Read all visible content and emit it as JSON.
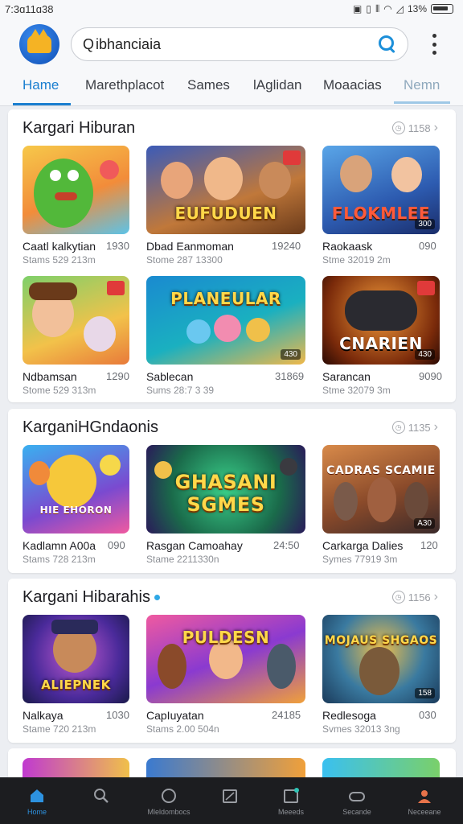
{
  "status_bar": {
    "time": "7:3ɑ11ɑ38",
    "battery": "13%"
  },
  "search": {
    "prefix": "Q",
    "value": "ibhanciaia"
  },
  "tabs": [
    "Hame",
    "Marethplacot",
    "Sames",
    "lAglidan",
    "Moaacias",
    "Nemn"
  ],
  "sections": [
    {
      "title": "Kargari Hiburan",
      "count": "1158",
      "items": [
        {
          "name": "Caatl kalkytian",
          "num": "1930",
          "sub": "Stams 529 213m",
          "thumb_text": "",
          "badge": ""
        },
        {
          "name": "Dbad Eanmoman",
          "num": "19240",
          "sub": "Stome 287 13300",
          "thumb_text": "EUFUDUEN",
          "badge": ""
        },
        {
          "name": "Raokaask",
          "num": "090",
          "sub": "Stme 32019 2m",
          "thumb_text": "FLOKMLEE",
          "badge": "300"
        },
        {
          "name": "Ndbamsan",
          "num": "1290",
          "sub": "Stome 529 313m",
          "thumb_text": "",
          "badge": ""
        },
        {
          "name": "Sablecan",
          "num": "31869",
          "sub": "Sums 28:7 3 39",
          "thumb_text": "PLANEULAR",
          "badge": "430"
        },
        {
          "name": "Sarancan",
          "num": "9090",
          "sub": "Stme 32079 3m",
          "thumb_text": "CNARIEN",
          "badge": "430"
        }
      ]
    },
    {
      "title": "KarganiHGndaonis",
      "count": "1135",
      "items": [
        {
          "name": "Kadlamn A00a",
          "num": "090",
          "sub": "Stams 728 213m",
          "thumb_text": "HIE EHORON",
          "badge": ""
        },
        {
          "name": "Rasgan Camoahay",
          "num": "24:50",
          "sub": "Stame 2211330n",
          "thumb_text": "GHASANI SGMES",
          "badge": ""
        },
        {
          "name": "Carkarga Dalies",
          "num": "120",
          "sub": "Symes 77919 3m",
          "thumb_text": "CADRAS SCAMIE",
          "badge": "A30"
        }
      ]
    },
    {
      "title": "Kargani Hibarahis",
      "count": "1156",
      "items": [
        {
          "name": "Nalkaya",
          "num": "1030",
          "sub": "Stame 720 213m",
          "thumb_text": "ALIEPNEK",
          "badge": ""
        },
        {
          "name": "CapIuyatan",
          "num": "24185",
          "sub": "Stams 2.00 504n",
          "thumb_text": "PULDESN",
          "badge": ""
        },
        {
          "name": "Redlesoga",
          "num": "030",
          "sub": "Svmes 32013 3ng",
          "thumb_text": "MOJAUS SHGAOS",
          "badge": "158"
        }
      ]
    }
  ],
  "bottom_nav": [
    {
      "label": "Home",
      "icon": "home-icon"
    },
    {
      "label": "",
      "icon": "search-icon"
    },
    {
      "label": "Mleldombocs",
      "icon": "circle-icon"
    },
    {
      "label": "",
      "icon": "clipboard-icon"
    },
    {
      "label": "Meeeds",
      "icon": "notifications-icon"
    },
    {
      "label": "Secande",
      "icon": "games-icon"
    },
    {
      "label": "Neceeane",
      "icon": "profile-icon"
    }
  ],
  "colors": {
    "accent": "#1b7fd0",
    "nav_bg": "#1c1d20"
  }
}
